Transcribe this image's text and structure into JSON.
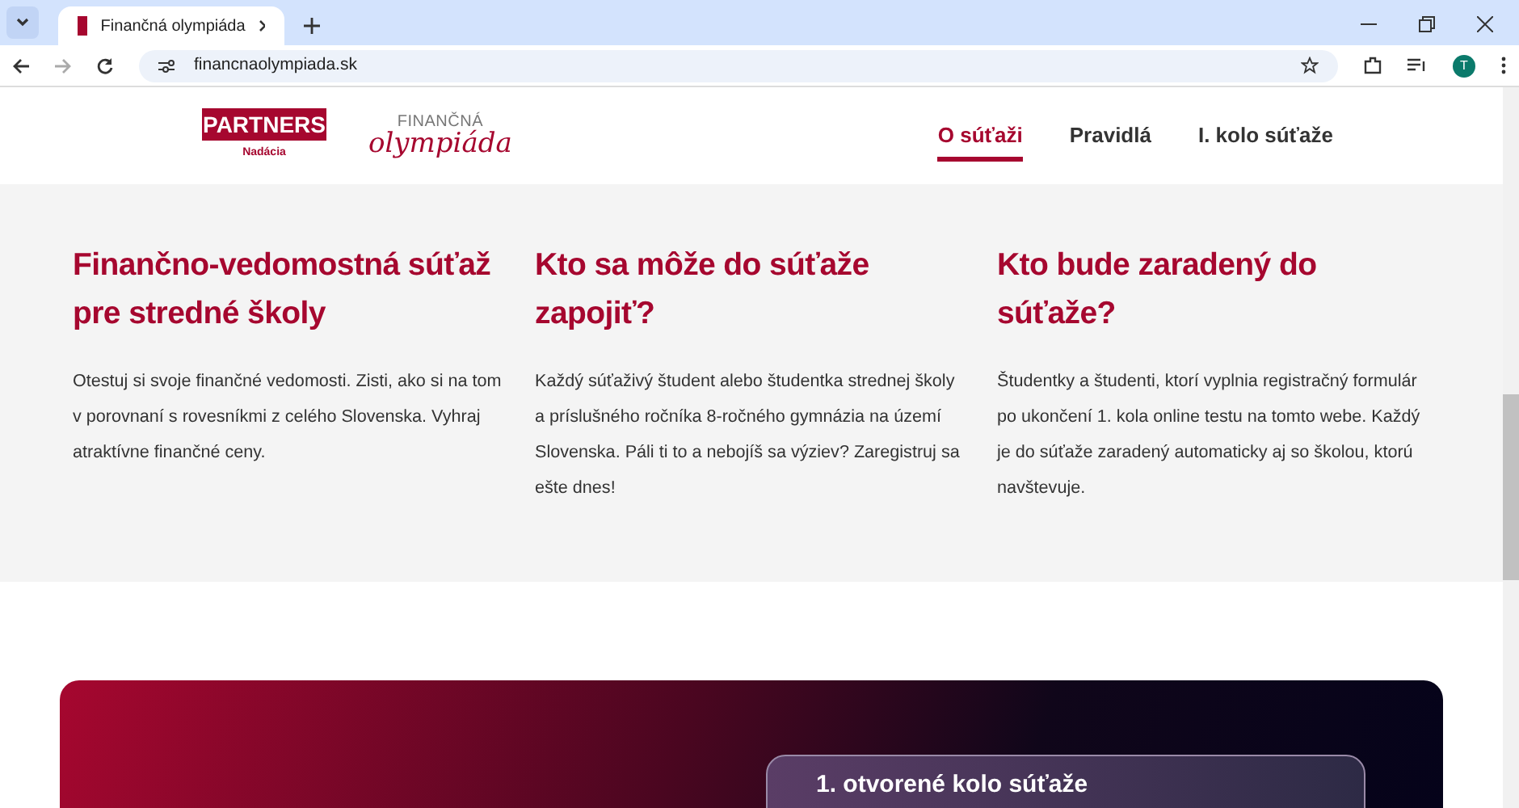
{
  "browser": {
    "tab_title": "Finančná olympiáda",
    "url": "financnaolympiada.sk",
    "profile_initial": "T"
  },
  "header": {
    "partners_logo": "PARTNERS",
    "partners_sub": "Nadácia",
    "brand_top": "FINANČNÁ",
    "brand_bottom": "olympiáda",
    "nav": [
      {
        "label": "O súťaži",
        "selected": true
      },
      {
        "label": "Pravidlá",
        "selected": false
      },
      {
        "label": "I. kolo súťaže",
        "selected": false
      }
    ]
  },
  "features": [
    {
      "title": "Finančno-vedomostná súťaž pre stredné školy",
      "text": "Otestuj si svoje finančné vedomosti. Zisti, ako si na tom v porovnaní s rovesníkmi z celého Slovenska. Vyhraj atraktívne finančné ceny."
    },
    {
      "title": "Kto sa môže do súťaže zapojiť?",
      "text": "Každý súťaživý študent alebo študentka strednej školy a príslušného ročníka 8-ročného gymnázia na území Slovenska. Páli ti to a nebojíš sa výziev? Zaregistruj sa ešte dnes!"
    },
    {
      "title": "Kto bude zaradený do súťaže?",
      "text": "Študentky a študenti, ktorí vyplnia registračný formulár po ukončení 1. kola online testu na tomto webe. Každý je do súťaže zaradený automaticky aj so školou, ktorú navštevuje."
    }
  ],
  "round_card": {
    "title": "1. otvorené kolo súťaže"
  }
}
